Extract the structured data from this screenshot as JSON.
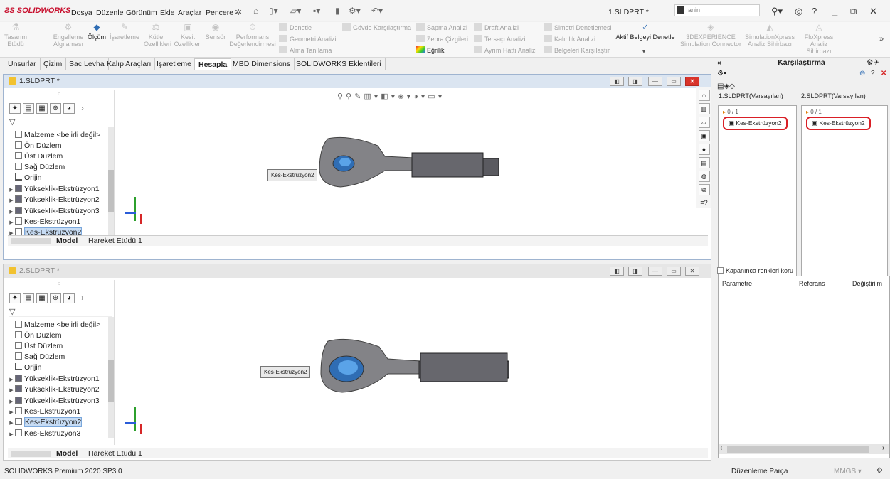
{
  "app": {
    "brand": "SOLIDWORKS",
    "doc_title": "1.SLDPRT *",
    "search_value": "anin"
  },
  "menu": [
    "Dosya",
    "Düzenle",
    "Görünüm",
    "Ekle",
    "Araçlar",
    "Pencere"
  ],
  "ribbon": {
    "big_buttons": [
      {
        "label": "Tasarım Etüdü",
        "active": false
      },
      {
        "label": "Engelleme Algılaması",
        "active": false
      },
      {
        "label": "Ölçüm",
        "active": true
      },
      {
        "label": "İşaretleme",
        "active": false
      },
      {
        "label": "Kütle Özellikleri",
        "active": false
      },
      {
        "label": "Kesit Özellikleri",
        "active": false
      },
      {
        "label": "Sensör",
        "active": false
      },
      {
        "label": "Performans Değerlendirmesi",
        "active": false
      }
    ],
    "small_col1": [
      "Denetle",
      "Geometri Analizi",
      "Alma Tanılama"
    ],
    "body_compare": "Gövde Karşılaştırma",
    "small_col2": [
      "Sapma Analizi",
      "Zebra Çizgileri",
      "Eğrilik"
    ],
    "small_col3": [
      "Draft Analizi",
      "Tersaçı Analizi",
      "Ayrım Hattı Analizi"
    ],
    "small_col4": [
      "Simetri Denetlemesi",
      "Kalınlık Analizi",
      "Belgeleri Karşılaştır"
    ],
    "active_doc_check": "Aktif Belgeyi Denetle",
    "right_buttons": [
      "3DEXPERIENCE Simulation Connector",
      "SimulationXpress Analiz Sihirbazı",
      "FloXpress Analiz Sihirbazı"
    ]
  },
  "tabs": [
    {
      "label": "Unsurlar",
      "active": false
    },
    {
      "label": "Çizim",
      "active": false
    },
    {
      "label": "Sac Levha",
      "active": false
    },
    {
      "label": "Kalıp Araçları",
      "active": false
    },
    {
      "label": "İşaretleme",
      "active": false
    },
    {
      "label": "Hesapla",
      "active": true
    },
    {
      "label": "MBD Dimensions",
      "active": false
    },
    {
      "label": "SOLIDWORKS Eklentileri",
      "active": false
    }
  ],
  "pane1": {
    "title": "1.SLDPRT *",
    "tree": [
      "Malzeme <belirli değil>",
      "Ön Düzlem",
      "Üst Düzlem",
      "Sağ Düzlem",
      "Orijin",
      "Yükseklik-Ekstrüzyon1",
      "Yükseklik-Ekstrüzyon2",
      "Yükseklik-Ekstrüzyon3",
      "Kes-Ekstrüzyon1",
      "Kes-Ekstrüzyon2"
    ],
    "callout": "Kes-Ekstrüzyon2",
    "model_tab": "Model",
    "motion_tab": "Hareket Etüdü 1"
  },
  "pane2": {
    "title": "2.SLDPRT *",
    "tree": [
      "Malzeme <belirli değil>",
      "Ön Düzlem",
      "Üst Düzlem",
      "Sağ Düzlem",
      "Orijin",
      "Yükseklik-Ekstrüzyon1",
      "Yükseklik-Ekstrüzyon2",
      "Yükseklik-Ekstrüzyon3",
      "Kes-Ekstrüzyon1",
      "Kes-Ekstrüzyon2",
      "Kes-Ekstrüzyon3"
    ],
    "callout": "Kes-Ekstrüzyon2",
    "model_tab": "Model",
    "motion_tab": "Hareket Etüdü 1"
  },
  "compare": {
    "title": "Karşılaştırma",
    "collapse": "«",
    "col1_header": "1.SLDPRT(Varsayılan)",
    "col2_header": "2.SLDPRT(Varsayılan)",
    "col1_count": "0 / 1",
    "col2_count": "0 / 1",
    "col1_feature": "Kes-Ekstrüzyon2",
    "col2_feature": "Kes-Ekstrüzyon2",
    "keep_colors": "Kapanınca renkleri koru",
    "table_headers": [
      "Parametre",
      "Referans",
      "Değiştirilm"
    ]
  },
  "status": {
    "left": "SOLIDWORKS Premium 2020 SP3.0",
    "mode": "Düzenleme Parça",
    "units": "MMGS"
  },
  "colors": {
    "accent": "#2f6db4",
    "highlight": "#d91f26",
    "brand": "#c8102e"
  }
}
